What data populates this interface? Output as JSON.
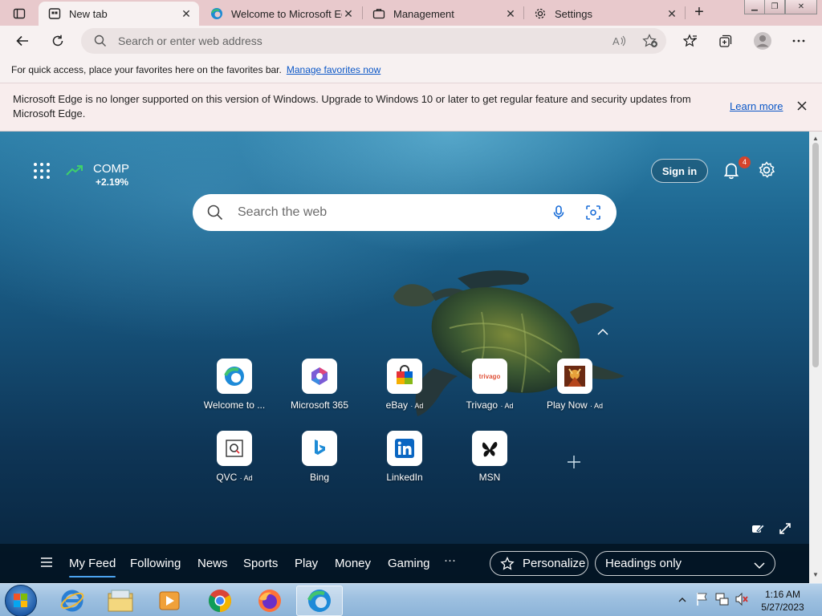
{
  "tabs": [
    {
      "title": "New tab",
      "active": true
    },
    {
      "title": "Welcome to Microsoft Edge",
      "active": false
    },
    {
      "title": "Management",
      "active": false
    },
    {
      "title": "Settings",
      "active": false
    }
  ],
  "address_bar": {
    "placeholder": "Search or enter web address"
  },
  "favorites_bar": {
    "message": "For quick access, place your favorites here on the favorites bar.",
    "link": "Manage favorites now"
  },
  "banner": {
    "message": "Microsoft Edge is no longer supported on this version of Windows. Upgrade to Windows 10 or later to get regular feature and security updates from Microsoft Edge.",
    "link": "Learn more"
  },
  "stock": {
    "symbol": "COMP",
    "change": "+2.19%",
    "trend_color": "#3fd16a"
  },
  "header": {
    "sign_in": "Sign in",
    "notification_count": "4"
  },
  "search": {
    "placeholder": "Search the web"
  },
  "quick_links": [
    {
      "label": "Welcome to ...",
      "ad": ""
    },
    {
      "label": "Microsoft 365",
      "ad": ""
    },
    {
      "label": "eBay",
      "ad": "· Ad"
    },
    {
      "label": "Trivago",
      "ad": "· Ad"
    },
    {
      "label": "Play Now",
      "ad": "· Ad"
    },
    {
      "label": "QVC",
      "ad": "· Ad"
    },
    {
      "label": "Bing",
      "ad": ""
    },
    {
      "label": "LinkedIn",
      "ad": ""
    },
    {
      "label": "MSN",
      "ad": ""
    }
  ],
  "trivago_logo_text": "trivago",
  "feed": {
    "items": [
      "My Feed",
      "Following",
      "News",
      "Sports",
      "Play",
      "Money",
      "Gaming"
    ],
    "active": "My Feed",
    "more": "···",
    "personalize": "Personalize",
    "layout_select": "Headings only"
  },
  "taskbar": {
    "apps": [
      "internet-explorer",
      "file-explorer",
      "media-player",
      "chrome",
      "firefox",
      "edge"
    ],
    "time": "1:16 AM",
    "date": "5/27/2023"
  },
  "colors": {
    "accent": "#0b57c7",
    "titlebar": "#e8c9cc",
    "badge": "#d5442c"
  }
}
